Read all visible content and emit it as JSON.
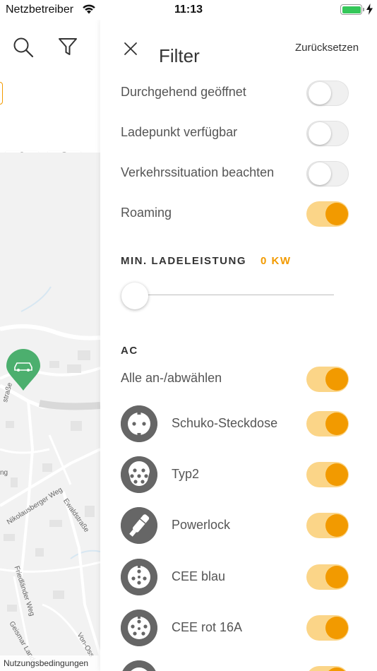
{
  "status_bar": {
    "carrier": "Netzbetreiber",
    "time": "11:13"
  },
  "map": {
    "street_labels": [
      "Nikolausberger Weg",
      "Ewaldstraße",
      "Friedländer Weg",
      "Geismar Land-",
      "Von-Oss",
      "straße",
      "ng"
    ],
    "footer": "Nutzungsbedingungen",
    "pin_color": "#4caf6e"
  },
  "filter": {
    "title": "Filter",
    "reset": "Zurücksetzen",
    "options": [
      {
        "label": "Durchgehend geöffnet",
        "on": false
      },
      {
        "label": "Ladepunkt verfügbar",
        "on": false
      },
      {
        "label": "Verkehrssituation beachten",
        "on": false
      },
      {
        "label": "Roaming",
        "on": true
      }
    ],
    "min_power": {
      "heading": "MIN. LADELEISTUNG",
      "value": "0 KW",
      "slider_fraction": 0
    },
    "ac": {
      "heading": "AC",
      "select_all": {
        "label": "Alle an-/abwählen",
        "on": true
      },
      "plugs": [
        {
          "label": "Schuko-Steckdose",
          "icon": "schuko-plug-icon",
          "on": true
        },
        {
          "label": "Typ2",
          "icon": "type2-plug-icon",
          "on": true
        },
        {
          "label": "Powerlock",
          "icon": "powerlock-plug-icon",
          "on": true
        },
        {
          "label": "CEE blau",
          "icon": "cee-blue-plug-icon",
          "on": true
        },
        {
          "label": "CEE rot 16A",
          "icon": "cee-red-plug-icon",
          "on": true
        }
      ]
    },
    "accent_color": "#f29a00"
  }
}
